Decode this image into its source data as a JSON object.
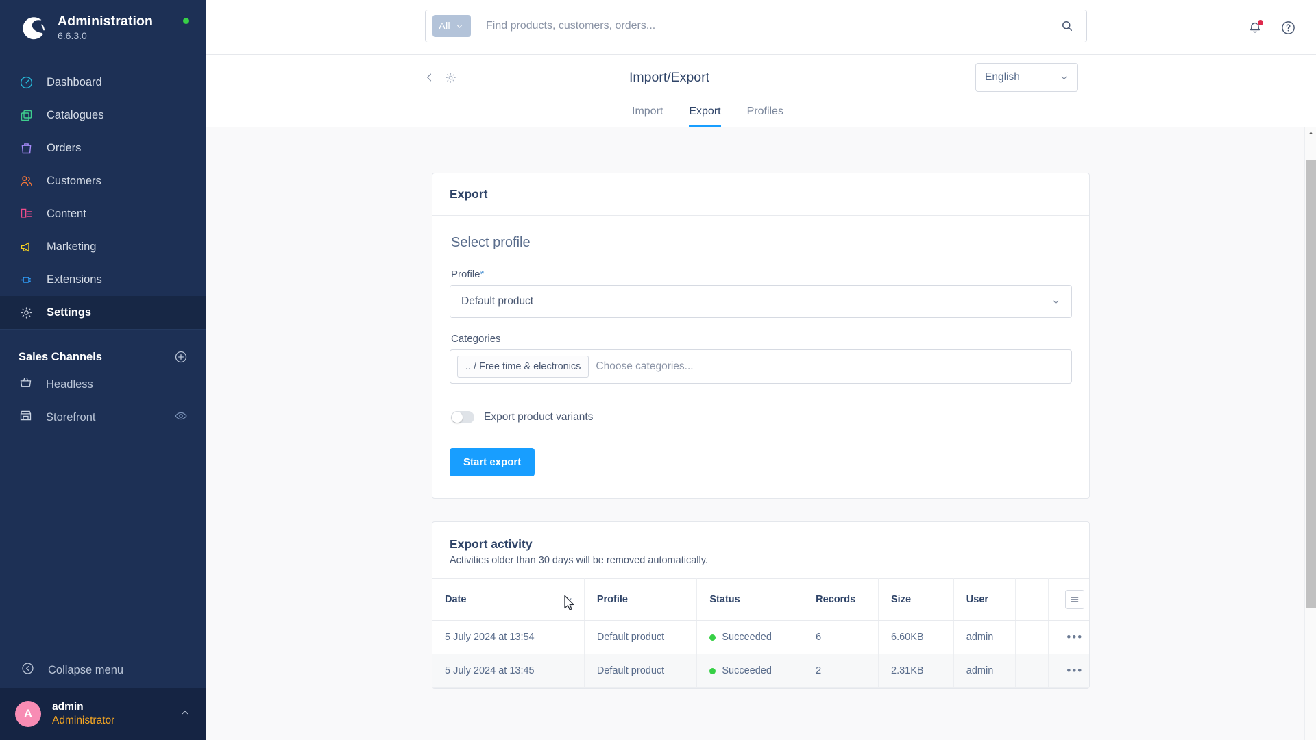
{
  "sidebar": {
    "app_title": "Administration",
    "version": "6.6.3.0",
    "status_color": "#37d046",
    "nav": [
      {
        "label": "Dashboard",
        "icon": "speedometer-icon",
        "color": "#26b6d6",
        "active": false
      },
      {
        "label": "Catalogues",
        "icon": "copy-icon",
        "color": "#3ecf8e",
        "active": false
      },
      {
        "label": "Orders",
        "icon": "bag-icon",
        "color": "#a78bfa",
        "active": false
      },
      {
        "label": "Customers",
        "icon": "users-icon",
        "color": "#f2763a",
        "active": false
      },
      {
        "label": "Content",
        "icon": "content-icon",
        "color": "#ef4c8b",
        "active": false
      },
      {
        "label": "Marketing",
        "icon": "megaphone-icon",
        "color": "#f5d020",
        "active": false
      },
      {
        "label": "Extensions",
        "icon": "plug-icon",
        "color": "#2f9bf6",
        "active": false
      },
      {
        "label": "Settings",
        "icon": "gear-icon",
        "color": "#c3cbd9",
        "active": true
      }
    ],
    "sales_channels": {
      "title": "Sales Channels",
      "add_label": "+",
      "items": [
        {
          "label": "Headless",
          "icon": "basket-icon",
          "has_preview": false
        },
        {
          "label": "Storefront",
          "icon": "shop-icon",
          "has_preview": true
        }
      ]
    },
    "collapse_label": "Collapse menu",
    "user": {
      "initial": "A",
      "name": "admin",
      "role": "Administrator",
      "avatar_color": "#f88cb4"
    }
  },
  "topbar": {
    "search_scope": "All",
    "search_placeholder": "Find products, customers, orders...",
    "search_value": "",
    "notification_badge_color": "#de294c"
  },
  "page_header": {
    "title": "Import/Export",
    "language": "English"
  },
  "tabs": [
    {
      "label": "Import",
      "active": false
    },
    {
      "label": "Export",
      "active": true
    },
    {
      "label": "Profiles",
      "active": false
    }
  ],
  "export_card": {
    "header": "Export",
    "section_title": "Select profile",
    "profile_label": "Profile",
    "profile_required": "*",
    "profile_value": "Default product",
    "categories_label": "Categories",
    "category_chips": [
      ".. / Free time & electronics"
    ],
    "categories_placeholder": "Choose categories...",
    "variants_toggle_label": "Export product variants",
    "variants_toggle_on": false,
    "start_button": "Start export",
    "accent_color": "#189eff"
  },
  "activity_card": {
    "title": "Export activity",
    "subtitle": "Activities older than 30 days will be removed automatically.",
    "columns": [
      "Date",
      "Profile",
      "Status",
      "Records",
      "Size",
      "User",
      "",
      ""
    ],
    "rows": [
      {
        "date": "5 July 2024 at 13:54",
        "profile": "Default product",
        "status": "Succeeded",
        "records": "6",
        "size": "6.60KB",
        "user": "admin",
        "actions": "•••"
      },
      {
        "date": "5 July 2024 at 13:45",
        "profile": "Default product",
        "status": "Succeeded",
        "records": "2",
        "size": "2.31KB",
        "user": "admin",
        "actions": "•••"
      }
    ],
    "status_ok_color": "#37d046"
  }
}
